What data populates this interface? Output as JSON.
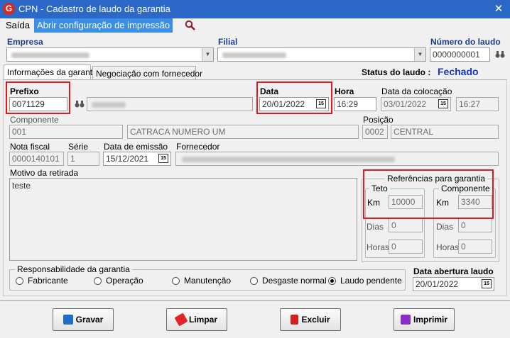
{
  "window": {
    "logo": "G",
    "title": "CPN - Cadastro de laudo da garantia",
    "close": "✕"
  },
  "menu": {
    "saida": "Saída",
    "config": "Abrir configuração de impressão"
  },
  "header": {
    "empresa_label": "Empresa",
    "filial_label": "Filial",
    "numero_label": "Número do laudo",
    "numero_value": "0000000001"
  },
  "tabs": {
    "info": "Informações da garantia",
    "negociacao": "Negociação com fornecedor"
  },
  "status": {
    "label": "Status do laudo :",
    "value": "Fechado"
  },
  "form": {
    "prefixo_label": "Prefixo",
    "prefixo_value": "0071129",
    "data_label": "Data",
    "data_value": "20/01/2022",
    "hora_label": "Hora",
    "hora_value": "16:29",
    "colocacao_label": "Data da colocação",
    "colocacao_date": "03/01/2022",
    "colocacao_time": "16:27",
    "componente_label": "Componente",
    "componente_code": "001",
    "componente_desc": "CATRACA NUMERO UM",
    "posicao_label": "Posição",
    "posicao_code": "0002",
    "posicao_desc": "CENTRAL",
    "nota_label": "Nota fiscal",
    "nota_value": "0000140101",
    "serie_label": "Série",
    "serie_value": "1",
    "emissao_label": "Data de emissão",
    "emissao_value": "15/12/2021",
    "fornecedor_label": "Fornecedor",
    "motivo_label": "Motivo da retirada",
    "motivo_value": "teste",
    "cal_text": "15"
  },
  "referencias": {
    "title": "Referências para garantia",
    "teto_title": "Teto",
    "componente_title": "Componente",
    "km_label": "Km",
    "dias_label": "Dias",
    "horas_label": "Horas",
    "teto_km": "10000",
    "teto_dias": "0",
    "teto_horas": "0",
    "comp_km": "3340",
    "comp_dias": "0",
    "comp_horas": "0"
  },
  "responsabilidade": {
    "title": "Responsabilidade da garantia",
    "options": [
      "Fabricante",
      "Operação",
      "Manutenção",
      "Desgaste normal",
      "Laudo pendente"
    ],
    "selected": "Laudo pendente"
  },
  "abertura": {
    "label": "Data abertura laudo",
    "value": "20/01/2022"
  },
  "buttons": {
    "gravar": "Gravar",
    "limpar": "Limpar",
    "excluir": "Excluir",
    "imprimir": "Imprimir"
  },
  "colors": {
    "titlebar": "#2b68c7",
    "menu_active": "#3a8ee6",
    "highlight": "#e01b1b",
    "status": "#1a35c8"
  }
}
